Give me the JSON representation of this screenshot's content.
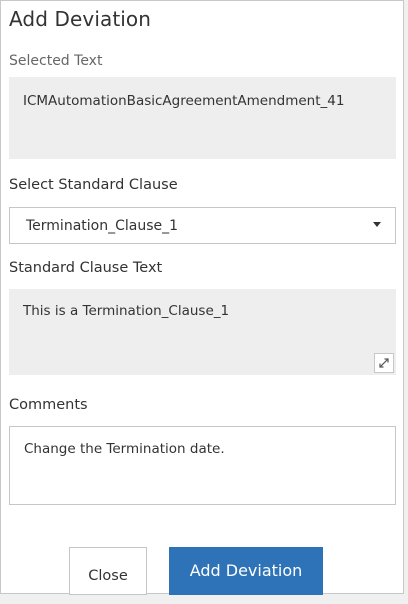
{
  "dialog": {
    "title": "Add Deviation",
    "selected_text_label": "Selected Text",
    "selected_text_value": "ICMAutomationBasicAgreementAmendment_41",
    "select_clause_label": "Select Standard Clause",
    "select_clause_value": "Termination_Clause_1",
    "standard_clause_label": "Standard Clause Text",
    "standard_clause_value": "This is a Termination_Clause_1",
    "comments_label": "Comments",
    "comments_value": "Change the Termination date."
  },
  "buttons": {
    "close_label": "Close",
    "add_label": "Add Deviation"
  },
  "icons": {
    "dropdown": "caret-down-icon",
    "expand": "expand-icon"
  },
  "colors": {
    "primary_button": "#2e73b8",
    "readonly_field_bg": "#eeeeee"
  }
}
